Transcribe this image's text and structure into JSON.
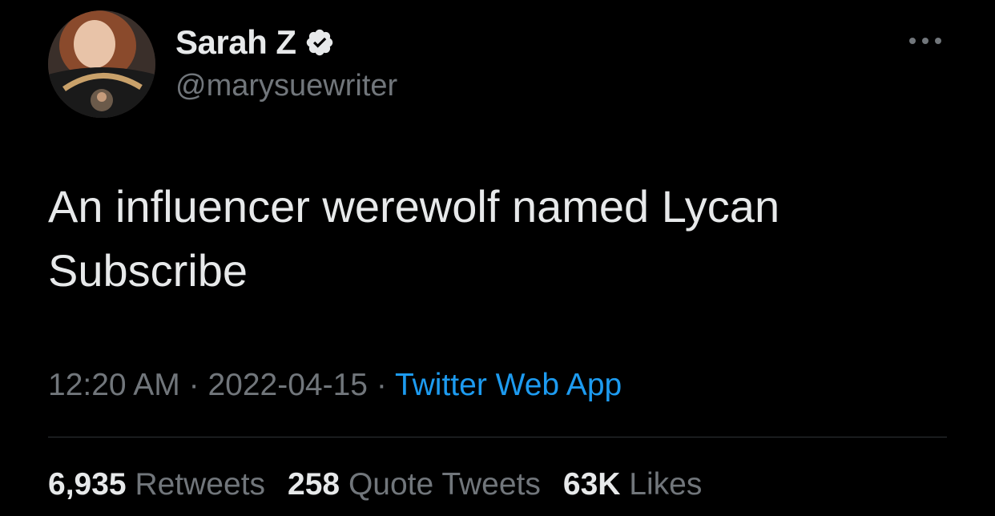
{
  "author": {
    "display_name": "Sarah Z",
    "handle": "@marysuewriter",
    "verified": true,
    "avatar_icon": "profile-photo"
  },
  "tweet": {
    "text": "An influencer werewolf named Lycan\nSubscribe"
  },
  "meta": {
    "time": "12:20 AM",
    "separator": "·",
    "date": "2022-04-15",
    "source": "Twitter Web App"
  },
  "stats": {
    "retweets": {
      "count": "6,935",
      "label": "Retweets"
    },
    "quotes": {
      "count": "258",
      "label": "Quote Tweets"
    },
    "likes": {
      "count": "63K",
      "label": "Likes"
    }
  },
  "colors": {
    "background": "#000000",
    "primary_text": "#e7e9ea",
    "secondary_text": "#71767b",
    "link": "#1d9bf0",
    "divider": "#2f3336"
  },
  "icons": {
    "verified": "verified-badge-icon",
    "more": "more-options-icon"
  }
}
